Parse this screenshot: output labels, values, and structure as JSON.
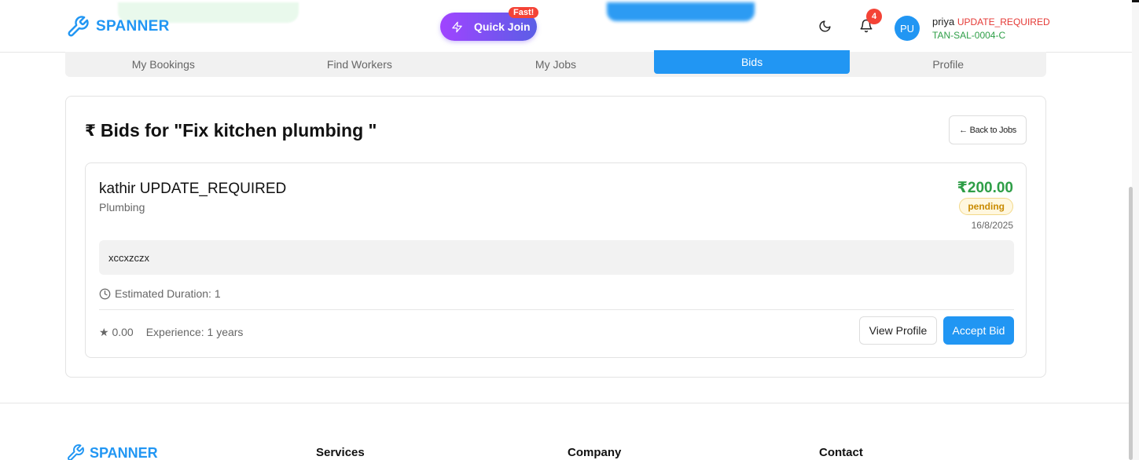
{
  "brand": {
    "name": "SPANNER"
  },
  "header": {
    "quick_join_label": "Quick Join",
    "fast_badge": "Fast!",
    "notification_count": "4",
    "avatar_initials": "PU",
    "user_name": "priya",
    "user_status": "UPDATE_REQUIRED",
    "user_id": "TAN-SAL-0004-C"
  },
  "tabs": [
    {
      "label": "My Bookings",
      "active": false
    },
    {
      "label": "Find Workers",
      "active": false
    },
    {
      "label": "My Jobs",
      "active": false
    },
    {
      "label": "Bids",
      "active": true
    },
    {
      "label": "Profile",
      "active": false
    }
  ],
  "page": {
    "currency_icon": "₹",
    "title": "Bids for \"Fix kitchen plumbing \"",
    "back_label": "← Back to Jobs"
  },
  "bid": {
    "bidder_name": "kathir UPDATE_REQUIRED",
    "skill": "Plumbing",
    "amount": "₹200.00",
    "status": "pending",
    "date": "16/8/2025",
    "message": "xccxzczx",
    "duration": "Estimated Duration: 1",
    "rating": "★ 0.00",
    "experience": "Experience: 1 years",
    "view_profile_label": "View Profile",
    "accept_label": "Accept Bid"
  },
  "footer": {
    "brand": "SPANNER",
    "columns": [
      "Services",
      "Company",
      "Contact"
    ]
  },
  "colors": {
    "primary": "#2196f3",
    "success": "#2e9e47",
    "danger": "#f44336",
    "pending": "#c98a00"
  }
}
